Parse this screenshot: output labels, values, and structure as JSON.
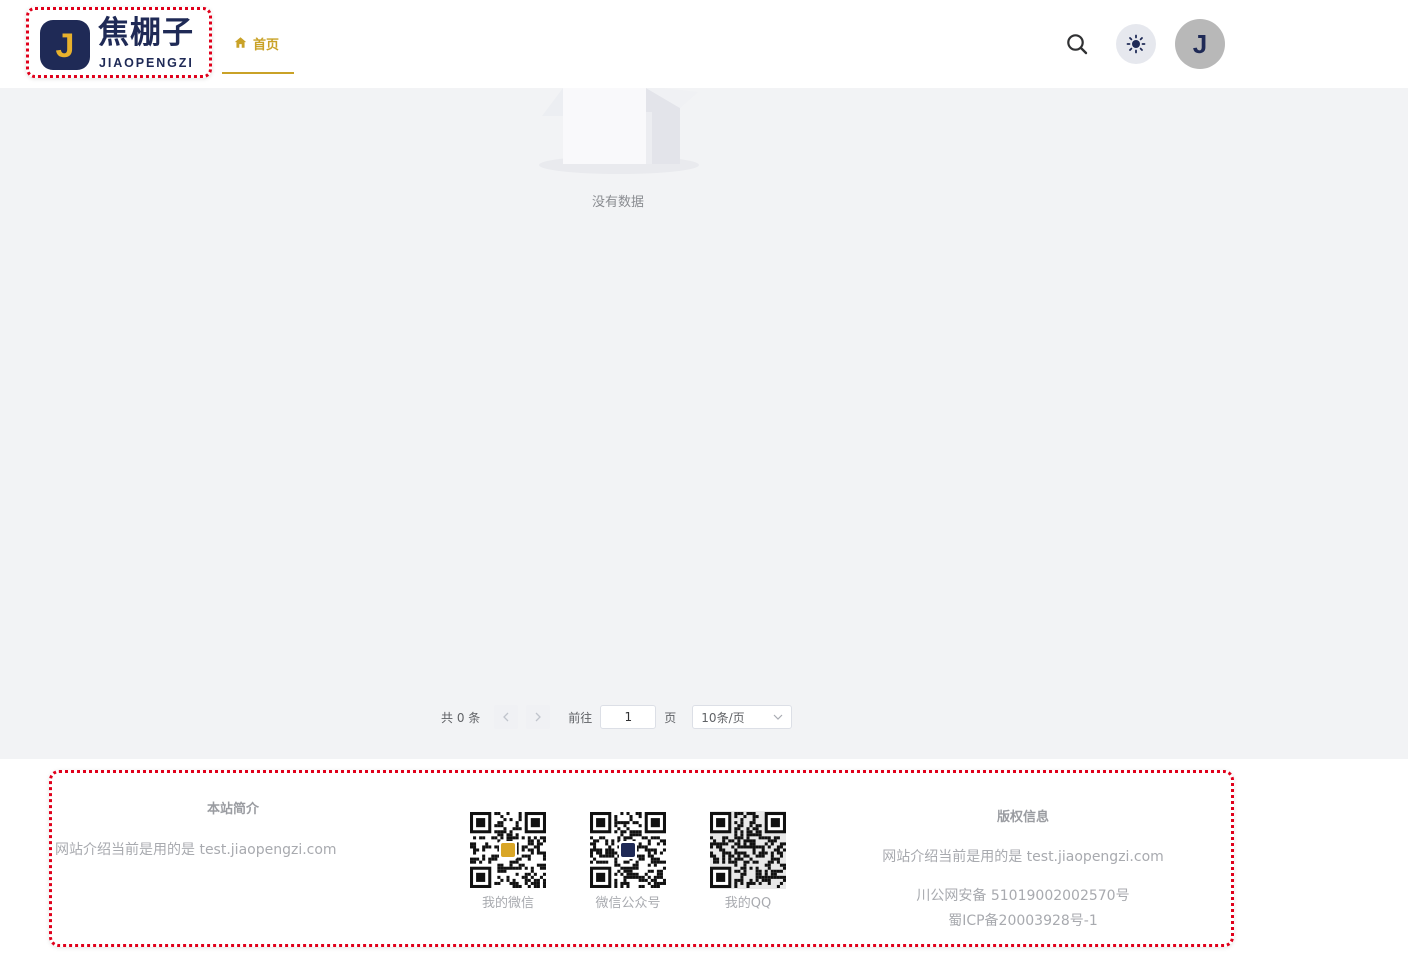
{
  "logo": {
    "mark_letter": "J",
    "name_cn": "焦棚子",
    "name_en": "JIAOPENGZI"
  },
  "nav": {
    "home_label": "首页",
    "home_icon": "home-icon"
  },
  "header_actions": {
    "search_icon": "search-icon",
    "theme_icon": "sun-icon",
    "avatar_letter": "J"
  },
  "main": {
    "empty_text": "没有数据"
  },
  "pagination": {
    "total": "共 0 条",
    "goto_label": "前往",
    "page_value": "1",
    "page_unit": "页",
    "page_size": "10条/页"
  },
  "footer": {
    "about_title": "本站简介",
    "about_text": "网站介绍当前是用的是 test.jiaopengzi.com",
    "qr_codes": [
      {
        "caption": "我的微信"
      },
      {
        "caption": "微信公众号"
      },
      {
        "caption": "我的QQ"
      }
    ],
    "copyright_title": "版权信息",
    "copyright_text": "网站介绍当前是用的是 test.jiaopengzi.com",
    "police_record": "川公网安备 51019002002570号",
    "icp_record": "蜀ICP备20003928号-1"
  },
  "colors": {
    "accent": "#c9a227",
    "brand_navy": "#1f2a56",
    "highlight_border": "#e0001b",
    "page_bg": "#f2f3f5"
  }
}
